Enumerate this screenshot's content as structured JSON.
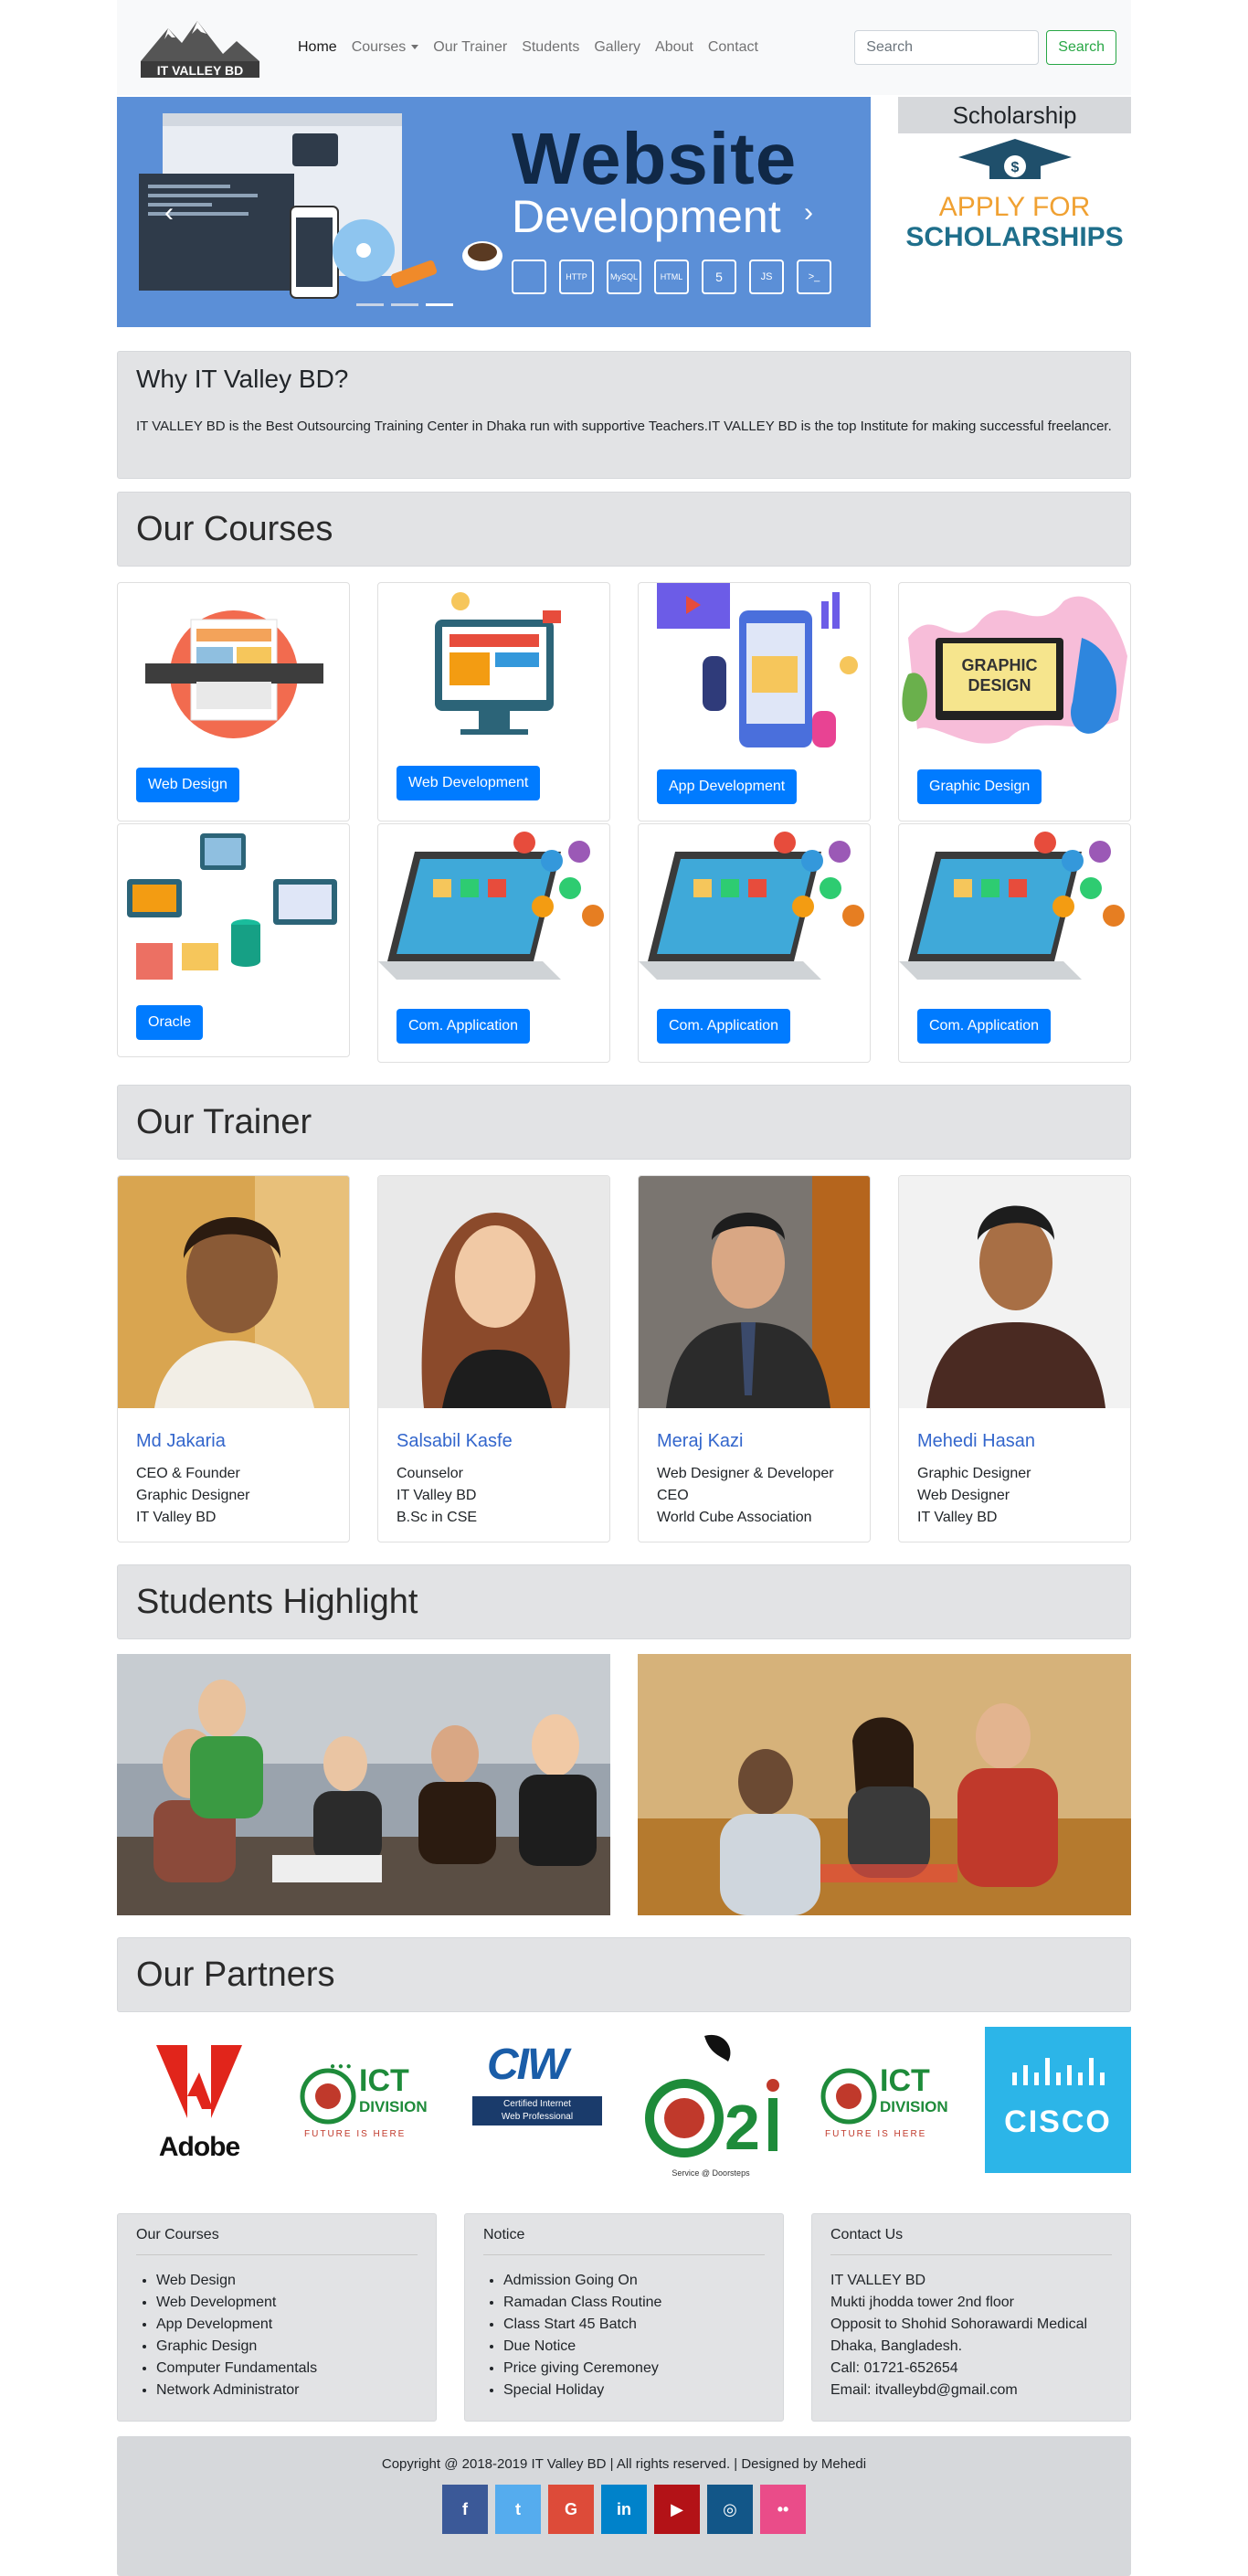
{
  "nav": {
    "logo_text": "IT VALLEY BD",
    "links": [
      {
        "label": "Home"
      },
      {
        "label": "Courses"
      },
      {
        "label": "Our Trainer"
      },
      {
        "label": "Students"
      },
      {
        "label": "Gallery"
      },
      {
        "label": "About"
      },
      {
        "label": "Contact"
      }
    ],
    "search_placeholder": "Search",
    "search_button": "Search"
  },
  "hero": {
    "title_line1": "Website",
    "title_line2": "Development",
    "badges": [
      "HTTP",
      "MySQL",
      "HTML",
      "5",
      "JS",
      ">_"
    ]
  },
  "scholarship": {
    "heading": "Scholarship",
    "line1": "APPLY FOR",
    "line2": "SCHOLARSHIPS"
  },
  "why": {
    "heading": "Why IT Valley BD?",
    "text": "IT VALLEY BD is the Best Outsourcing Training Center in Dhaka run with supportive Teachers.IT VALLEY BD is the top Institute for making successful freelancer."
  },
  "courses": {
    "heading": "Our Courses",
    "items": [
      {
        "label": "Web Design"
      },
      {
        "label": "Web Development"
      },
      {
        "label": "App Development"
      },
      {
        "label": "Graphic Design"
      },
      {
        "label": "Oracle"
      },
      {
        "label": "Com. Application"
      },
      {
        "label": "Com. Application"
      },
      {
        "label": "Com. Application"
      }
    ]
  },
  "trainers": {
    "heading": "Our Trainer",
    "items": [
      {
        "name": "Md Jakaria",
        "lines": [
          "CEO & Founder",
          "Graphic Designer",
          "IT Valley BD"
        ]
      },
      {
        "name": "Salsabil Kasfe",
        "lines": [
          "Counselor",
          "IT Valley BD",
          "B.Sc in CSE"
        ]
      },
      {
        "name": "Meraj Kazi",
        "lines": [
          "Web Designer & Developer",
          "CEO",
          "World Cube Association"
        ]
      },
      {
        "name": "Mehedi Hasan",
        "lines": [
          "Graphic Designer",
          "Web Designer",
          "IT Valley BD"
        ]
      }
    ]
  },
  "students": {
    "heading": "Students Highlight"
  },
  "partners": {
    "heading": "Our Partners",
    "adobe": "Adobe",
    "ict_main": "ICT",
    "ict_sub": "DIVISION",
    "ict_tag": "FUTURE IS HERE",
    "ciw": "CIW",
    "ciw_sub1": "Certified Internet",
    "ciw_sub2": "Web Professional",
    "a2i": "a2i",
    "a2i_sub": "Service @ Doorsteps",
    "cisco": "CISCO"
  },
  "footer": {
    "courses": {
      "title": "Our Courses",
      "items": [
        "Web Design",
        "Web Development",
        "App Development",
        "Graphic Design",
        "Computer Fundamentals",
        "Network Administrator"
      ]
    },
    "notice": {
      "title": "Notice",
      "items": [
        "Admission Going On",
        "Ramadan Class Routine",
        "Class Start 45 Batch",
        "Due Notice",
        "Price giving Ceremoney",
        "Special Holiday"
      ]
    },
    "contact": {
      "title": "Contact Us",
      "lines": [
        "IT VALLEY BD",
        "Mukti jhodda tower 2nd floor",
        "Opposit to Shohid Sohorawardi Medical",
        "Dhaka, Bangladesh.",
        "Call: 01721-652654",
        "Email: itvalleybd@gmail.com"
      ]
    },
    "copyright": "Copyright @ 2018-2019 IT Valley BD | All rights reserved. | Designed by Mehedi",
    "social": [
      {
        "icon": "facebook-icon",
        "glyph": "f",
        "color": "#3b5998"
      },
      {
        "icon": "twitter-icon",
        "glyph": "t",
        "color": "#55acee"
      },
      {
        "icon": "google-icon",
        "glyph": "G",
        "color": "#dd4b39"
      },
      {
        "icon": "linkedin-icon",
        "glyph": "in",
        "color": "#0082ca"
      },
      {
        "icon": "youtube-icon",
        "glyph": "▶",
        "color": "#b31217"
      },
      {
        "icon": "instagram-icon",
        "glyph": "◎",
        "color": "#125688"
      },
      {
        "icon": "flickr-icon",
        "glyph": "••",
        "color": "#ea4c89"
      }
    ]
  }
}
